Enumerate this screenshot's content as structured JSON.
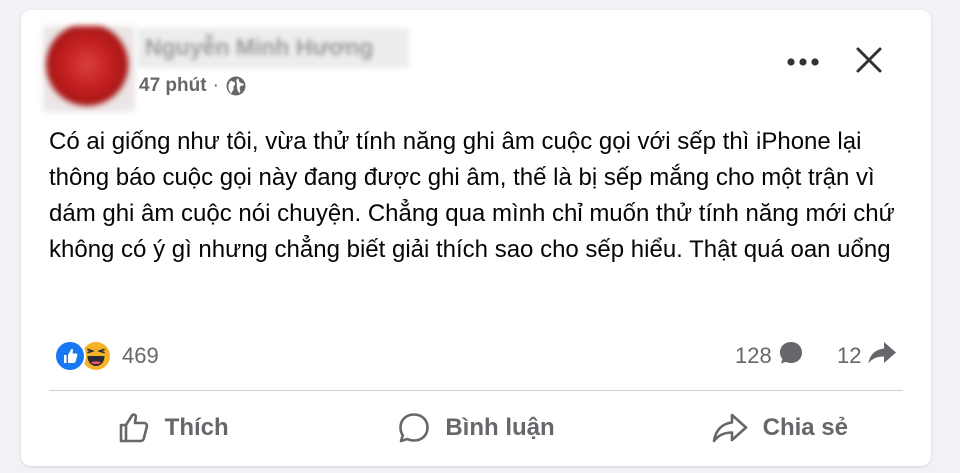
{
  "post": {
    "author_name": "Nguyễn Minh Hương",
    "time": "47 phút",
    "separator": "·",
    "privacy_icon": "globe-icon",
    "text": "Có ai giống như tôi, vừa thử tính năng ghi âm cuộc gọi với sếp thì iPhone lại thông báo cuộc gọi này đang được ghi âm, thế là bị sếp mắng cho một trận vì dám ghi âm cuộc nói chuyện. Chẳng qua mình chỉ muốn thử tính năng mới chứ không có ý gì nhưng chẳng biết giải thích sao cho sếp hiểu. Thật quá oan uổng"
  },
  "header_actions": {
    "more_icon": "more-horizontal-icon",
    "close_icon": "close-icon"
  },
  "stats": {
    "reaction_icons": [
      "like-reaction-icon",
      "haha-reaction-icon"
    ],
    "reaction_count": "469",
    "comment_count": "128",
    "share_count": "12"
  },
  "actions": {
    "like_label": "Thích",
    "comment_label": "Bình luận",
    "share_label": "Chia sẻ"
  },
  "colors": {
    "like_blue": "#1877f2",
    "haha_yellow": "#f7b125",
    "secondary_text": "#65676b",
    "background": "#f0f2f5"
  }
}
